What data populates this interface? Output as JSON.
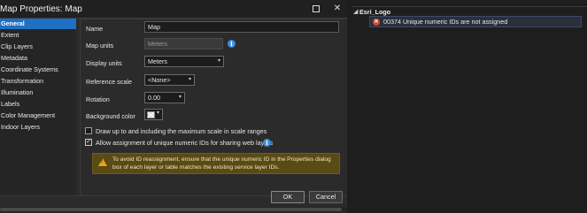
{
  "dialog": {
    "title": "Map Properties: Map",
    "maximize_icon": "maximize-icon",
    "close_label": "✕",
    "nav": [
      {
        "label": "General",
        "active": true
      },
      {
        "label": "Extent"
      },
      {
        "label": "Clip Layers"
      },
      {
        "label": "Metadata"
      },
      {
        "label": "Coordinate Systems"
      },
      {
        "label": "Transformation"
      },
      {
        "label": "Illumination"
      },
      {
        "label": "Labels"
      },
      {
        "label": "Color Management"
      },
      {
        "label": "Indoor Layers"
      }
    ],
    "general": {
      "name_label": "Name",
      "name_value": "Map",
      "map_units_label": "Map units",
      "map_units_value": "Meters",
      "display_units_label": "Display units",
      "display_units_value": "Meters",
      "reference_scale_label": "Reference scale",
      "reference_scale_value": "<None>",
      "rotation_label": "Rotation",
      "rotation_value": "0.00",
      "background_color_label": "Background color",
      "draw_up_to_label": "Draw up to and including the maximum scale in scale ranges",
      "draw_up_to_checked": false,
      "allow_ids_label": "Allow assignment of unique numeric IDs for sharing web layers",
      "allow_ids_checked": true,
      "warning_text": "To avoid ID reassignment, ensure that the unique numeric ID in the Properties dialog box of each layer or table matches the existing service layer IDs."
    },
    "buttons": {
      "ok": "OK",
      "cancel": "Cancel"
    }
  },
  "messages_panel": {
    "group_title": "Esri_Logo",
    "items": [
      {
        "code_text": "00374 Unique numeric IDs are not assigned",
        "severity": "error",
        "icon": "error-icon"
      }
    ]
  },
  "colors": {
    "accent": "#1f6fc4",
    "warning_bg": "#5a4a14",
    "warning_icon": "#e8a317",
    "error": "#d9482b",
    "info": "#3b8ede"
  }
}
